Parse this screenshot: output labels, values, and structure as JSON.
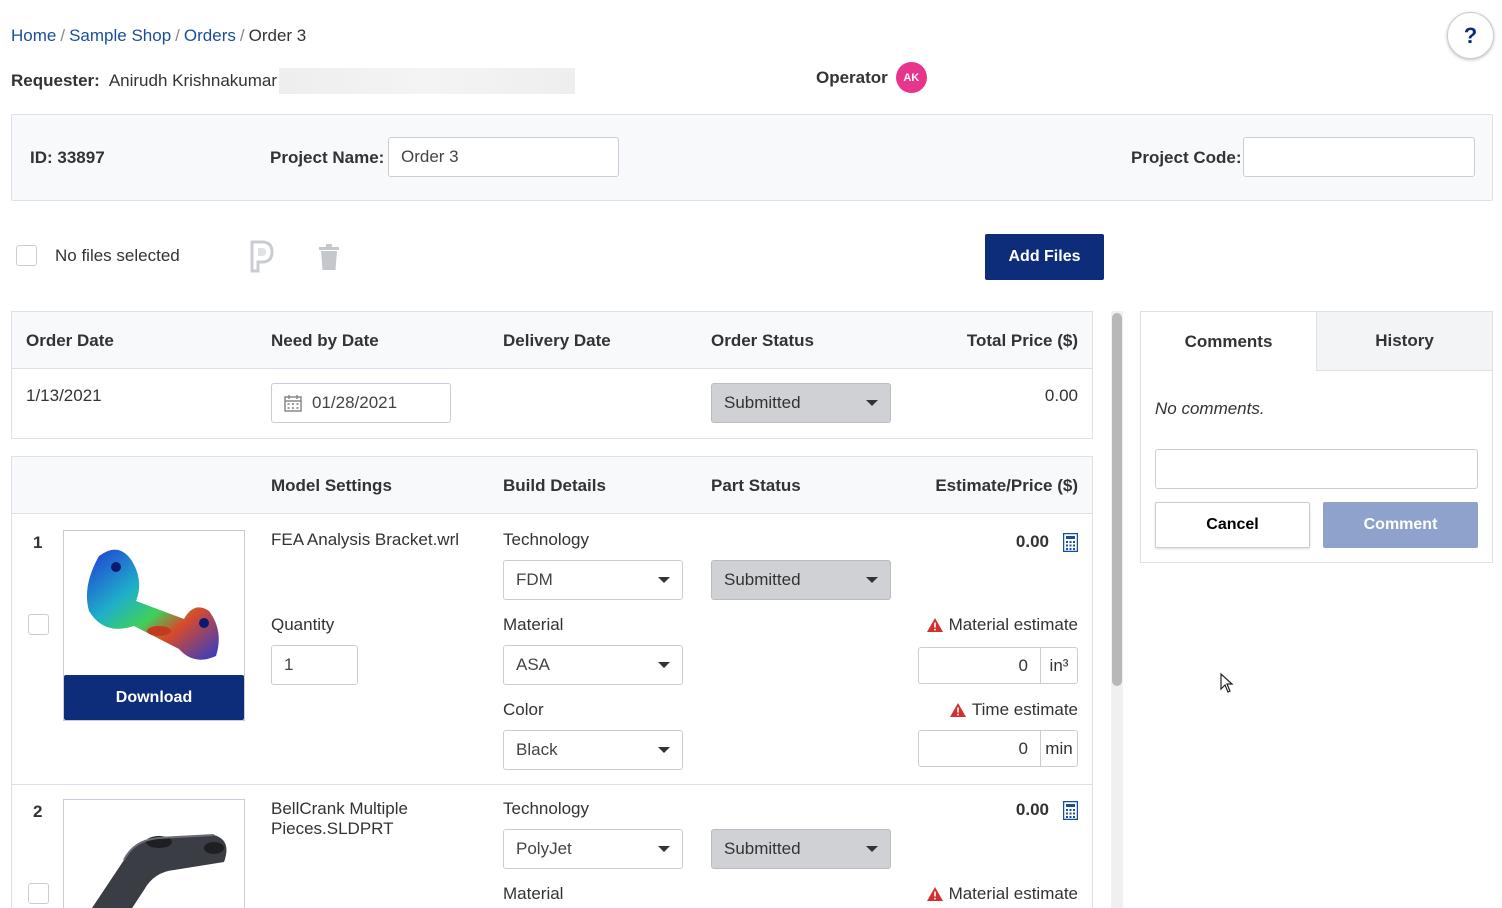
{
  "breadcrumb": {
    "items": [
      "Home",
      "Sample Shop",
      "Orders"
    ],
    "current": "Order 3",
    "separator": "/"
  },
  "help": {
    "label": "?"
  },
  "requester": {
    "label": "Requester:",
    "name": "Anirudh Krishnakumar"
  },
  "operator": {
    "label": "Operator",
    "initials": "AK"
  },
  "project": {
    "id_text": "ID: 33897",
    "name_label": "Project Name:",
    "name_value": "Order 3",
    "code_label": "Project Code:",
    "code_value": ""
  },
  "files": {
    "selection_text": "No files selected",
    "add_label": "Add Files"
  },
  "order": {
    "headers": {
      "order_date": "Order Date",
      "need_by": "Need by Date",
      "delivery": "Delivery Date",
      "status": "Order Status",
      "total": "Total Price ($)"
    },
    "order_date": "1/13/2021",
    "need_by_date": "01/28/2021",
    "delivery_date": "",
    "status": "Submitted",
    "total_price": "0.00"
  },
  "parts": {
    "headers": {
      "model": "Model Settings",
      "build": "Build Details",
      "status": "Part Status",
      "estimate": "Estimate/Price ($)"
    },
    "download_label": "Download",
    "labels": {
      "technology": "Technology",
      "material": "Material",
      "color": "Color",
      "quantity": "Quantity",
      "material_estimate": "Material estimate",
      "time_estimate": "Time estimate"
    },
    "items": [
      {
        "index": "1",
        "filename": "FEA Analysis Bracket.wrl",
        "quantity": "1",
        "technology": "FDM",
        "material": "ASA",
        "color": "Black",
        "status": "Submitted",
        "price": "0.00",
        "material_estimate": "0",
        "material_unit": "in³",
        "time_estimate": "0",
        "time_unit": "min"
      },
      {
        "index": "2",
        "filename": "BellCrank Multiple Pieces.SLDPRT",
        "technology": "PolyJet",
        "status": "Submitted",
        "price": "0.00"
      }
    ]
  },
  "comments": {
    "tabs": [
      "Comments",
      "History"
    ],
    "empty_text": "No comments.",
    "input_value": "",
    "cancel_label": "Cancel",
    "submit_label": "Comment"
  },
  "colors": {
    "primary": "#0d2c7a",
    "link": "#1a4e9c",
    "avatar": "#e9348c",
    "warning": "#d32f2f",
    "disabled_button": "#8fa2cc"
  }
}
